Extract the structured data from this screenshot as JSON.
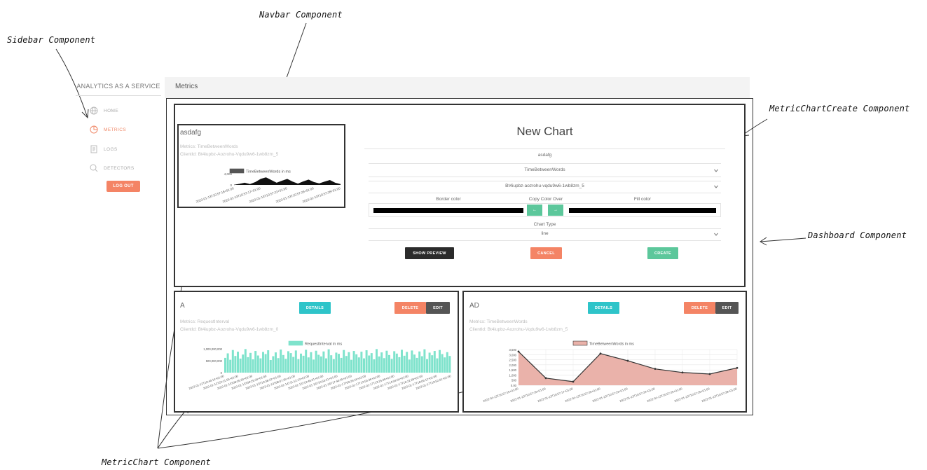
{
  "annotations": {
    "navbar": "Navbar Component",
    "sidebar": "Sidebar Component",
    "metric_chart_create": "MetricChartCreate Component",
    "dashboard": "Dashboard Component",
    "metric_chart": "MetricChart Component"
  },
  "sidebar": {
    "brand": "ANALYTICS AS A SERVICE",
    "items": [
      {
        "label": "HOME",
        "icon": "globe-icon",
        "active": false
      },
      {
        "label": "METRICS",
        "icon": "pie-chart-icon",
        "active": true
      },
      {
        "label": "LOGS",
        "icon": "document-icon",
        "active": false
      },
      {
        "label": "DETECTORS",
        "icon": "search-icon",
        "active": false
      }
    ],
    "logout_label": "LOG OUT"
  },
  "navbar": {
    "title": "Metrics"
  },
  "preview": {
    "title": "asdafg",
    "metrics": "Metrics: TimeBetweenWords",
    "client": "ClientId: Bt4iupbz-Aozrohu-Vqdu9w6-1wb8zm_5",
    "legend": "TimeBetweenWords in ms",
    "y_ticks": [
      "4,000",
      "0"
    ],
    "x_ticks": [
      "2022-01-13T10:57:18+01:00",
      "2022-01-13T10:57:17+01:00",
      "2022-01-13T10:57:22+01:00",
      "2022-01-13T10:57:29+01:00",
      "2022-01-13T10:57:28+01:00"
    ]
  },
  "create_form": {
    "heading": "New Chart",
    "name_value": "asdafg",
    "metric_value": "TimeBetweenWords",
    "client_value": "Bt4iupbz-aozrohu-vqdu9w6-1wb8zm_5",
    "border_label": "Border color",
    "copy_label": "Copy Color Over",
    "fill_label": "Fill color",
    "copy_left_glyph": "←",
    "copy_right_glyph": "→",
    "chart_type_label": "Chart Type",
    "chart_type_value": "line",
    "show_preview_label": "SHOW PREVIEW",
    "cancel_label": "CANCEL",
    "create_label": "CREATE"
  },
  "chart_cards": [
    {
      "title": "A",
      "metrics": "Metrics: RequestInterval",
      "client": "ClientId: Bt4iupbz-Aozrohu-Vqdu9w6-1wb8zm_0",
      "details_label": "DETAILS",
      "delete_label": "DELETE",
      "edit_label": "EDIT"
    },
    {
      "title": "AD",
      "metrics": "Metrics: TimeBetweenWords",
      "client": "ClientId: Bt4iupbz-Aozrohu-Vqdu9w6-1wb8zm_5",
      "details_label": "DETAILS",
      "delete_label": "DELETE",
      "edit_label": "EDIT"
    }
  ],
  "colors": {
    "accent_orange": "#f48465",
    "teal": "#2ec4c9",
    "green": "#5cc79b",
    "dark": "#555555",
    "bar_fill": "#7fe3cc",
    "area_fill": "#eab2aa"
  },
  "chart_data": [
    {
      "type": "area",
      "series": [
        {
          "name": "TimeBetweenWords in ms",
          "values": [
            0,
            400,
            900,
            300,
            1200,
            2600,
            3300,
            2100,
            900,
            1800,
            2600,
            1400,
            500,
            1500,
            2300,
            1200,
            600,
            1400,
            2100,
            900,
            300
          ]
        }
      ],
      "yticks": [
        "4,000",
        "0"
      ],
      "ylim": [
        0,
        5000
      ],
      "xticks": [
        "2022-01-13T10:57:18+01:00",
        "2022-01-13T10:57:17+01:00",
        "2022-01-13T10:57:22+01:00",
        "2022-01-13T10:57:29+01:00",
        "2022-01-13T10:57:28+01:00"
      ],
      "legend": "top",
      "grid": false
    },
    {
      "type": "bar",
      "series": [
        {
          "name": "RequestInterval in ms",
          "values": [
            620,
            810,
            540,
            950,
            700,
            880,
            590,
            760,
            990,
            650,
            830,
            560,
            910,
            720,
            600,
            870,
            780,
            940,
            530,
            690,
            850,
            610,
            970,
            740,
            580,
            900,
            820,
            660,
            930,
            570,
            800,
            710,
            960,
            640,
            860,
            550,
            920,
            750,
            680,
            890,
            600,
            980,
            730,
            570,
            840,
            790,
            620,
            950,
            700,
            860,
            540,
            910,
            770,
            640,
            880,
            600,
            940,
            720,
            820,
            560,
            990,
            680,
            850,
            610,
            920,
            740,
            580,
            900,
            800,
            650,
            960,
            710,
            870,
            550,
            930,
            760,
            620,
            890,
            690,
            980,
            570,
            840,
            730,
            910,
            600,
            950,
            780,
            640,
            860,
            700
          ]
        }
      ],
      "value_unit": "millions",
      "yticks": [
        "1,000,000,000",
        "500,000,000",
        "0"
      ],
      "ylim": [
        0,
        1000
      ],
      "xticks": [
        "2022-01-12T10:44:14+01:00",
        "2022-01-12T22:11:55+01:00",
        "2022-01-13T08:35:30+01:00",
        "2022-01-13T09:25:34+01:00",
        "2022-01-13T10:38:22+01:00",
        "2022-01-14T08:07:25+01:00",
        "2022-01-14T11:12:13+01:00",
        "2022-01-15T13:46:01+01:00",
        "2022-01-16T10:53:21+01:00",
        "2022-01-16T17:40:45+01:00",
        "2022-01-17T09:25:16+01:00",
        "2022-01-17T12:54:36+01:00",
        "2022-01-17T13:25:09+01:00",
        "2022-01-17T14:04:04+01:00",
        "2022-01-17T16:22:28+01:00",
        "2022-01-17T18:05:12+01:00",
        "2022-01-17T19:52:01+01:00"
      ],
      "legend": "top",
      "grid": false
    },
    {
      "type": "area",
      "series": [
        {
          "name": "TimeBetweenWords in ms",
          "values": [
            3300,
            700,
            350,
            3100,
            2400,
            1600,
            1250,
            1100,
            1700
          ]
        }
      ],
      "yticks": [
        "3,500",
        "3,000",
        "2,500",
        "2,000",
        "1,500",
        "1,000",
        "500",
        "0.00"
      ],
      "ylim": [
        0,
        3500
      ],
      "xticks": [
        "2022-01-13T10:57:15+01:00",
        "2022-01-13T10:57:16+01:00",
        "2022-01-13T10:57:17+01:00",
        "2022-01-13T10:57:20+01:00",
        "2022-01-13T10:57:22+01:00",
        "2022-01-13T10:57:24+01:00",
        "2022-01-13T10:57:25+01:00",
        "2022-01-13T10:57:26+01:00",
        "2022-01-13T10:57:28+01:00"
      ],
      "legend": "top",
      "grid": true
    }
  ]
}
